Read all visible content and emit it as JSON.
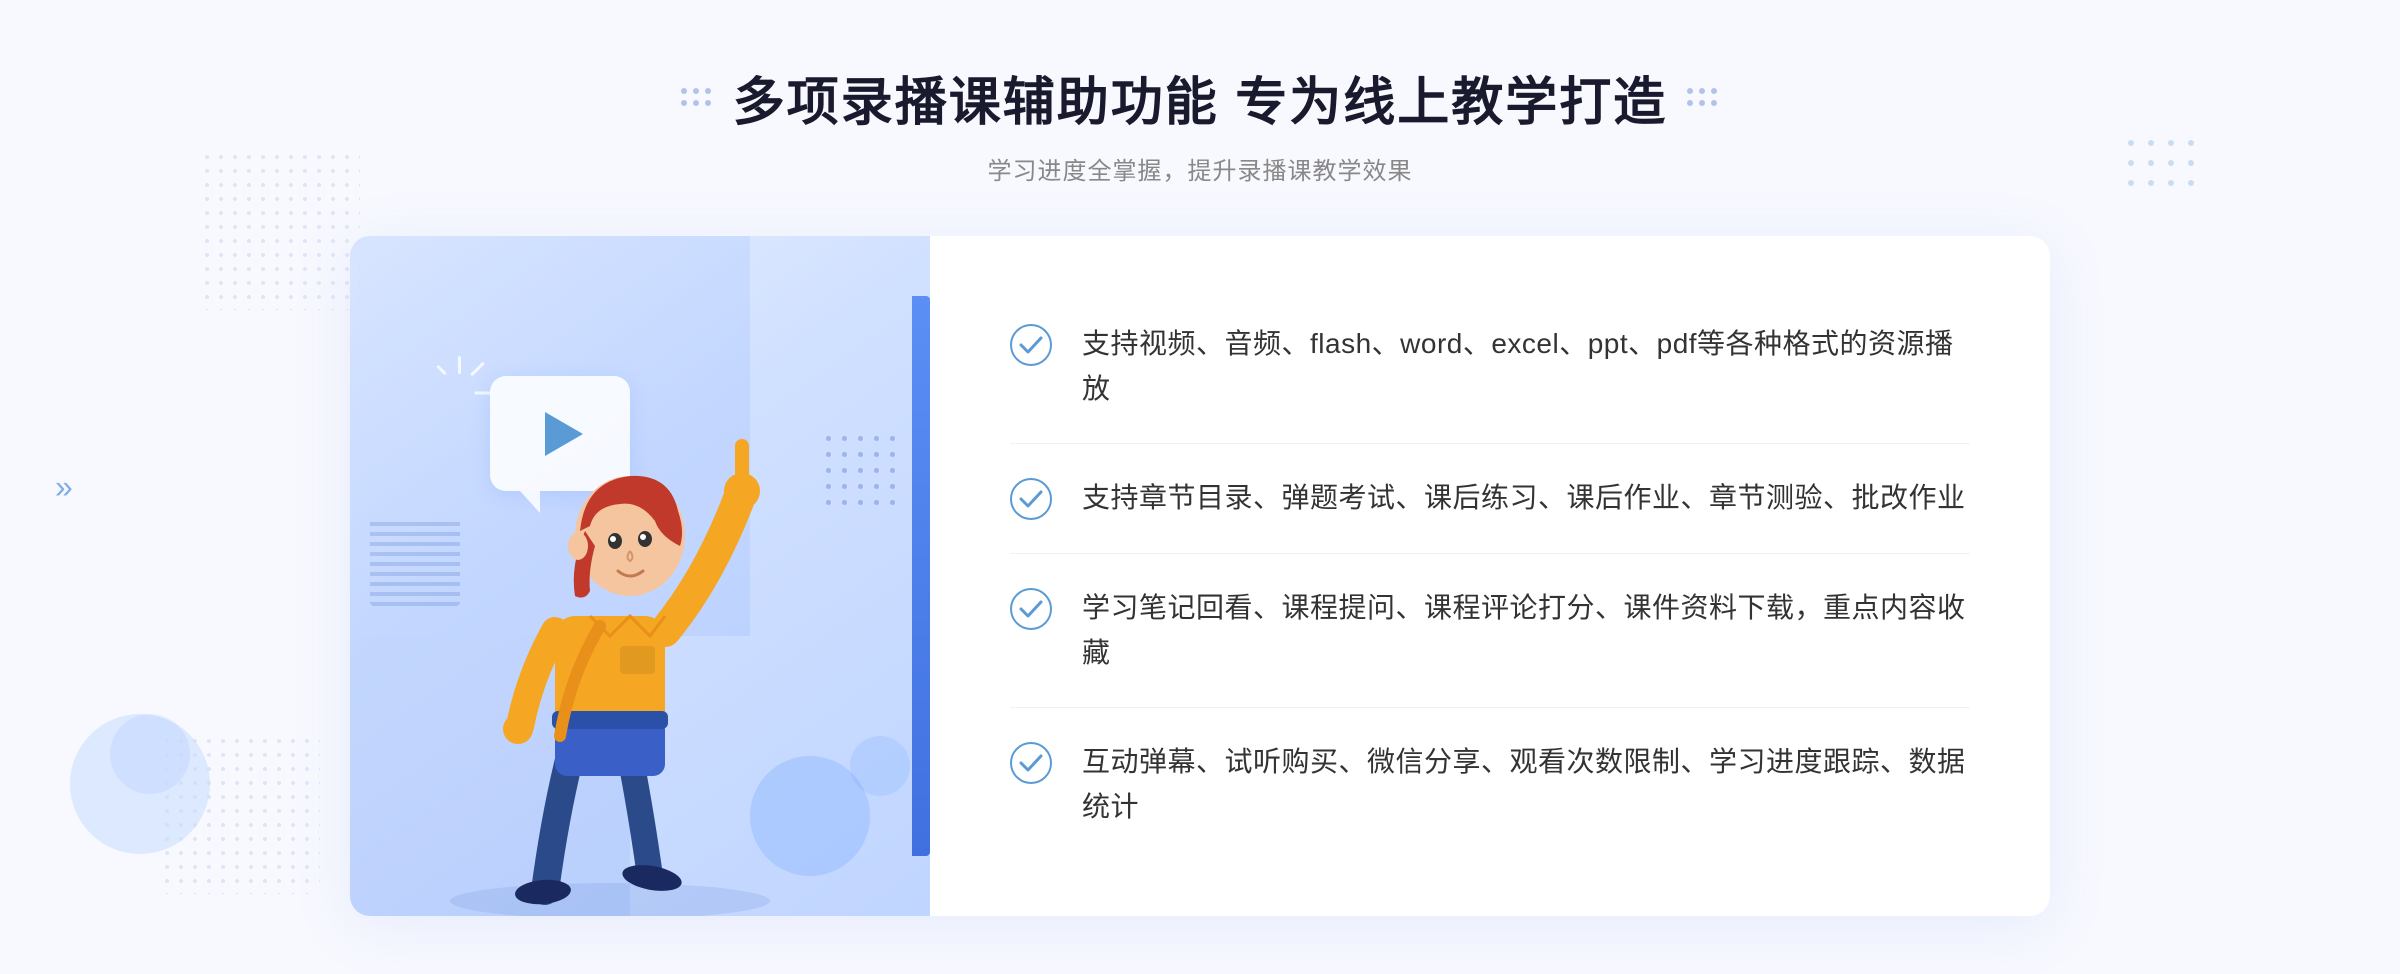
{
  "header": {
    "title": "多项录播课辅助功能 专为线上教学打造",
    "subtitle": "学习进度全掌握，提升录播课教学效果"
  },
  "features": [
    {
      "id": 1,
      "text": "支持视频、音频、flash、word、excel、ppt、pdf等各种格式的资源播放"
    },
    {
      "id": 2,
      "text": "支持章节目录、弹题考试、课后练习、课后作业、章节测验、批改作业"
    },
    {
      "id": 3,
      "text": "学习笔记回看、课程提问、课程评论打分、课件资料下载，重点内容收藏"
    },
    {
      "id": 4,
      "text": "互动弹幕、试听购买、微信分享、观看次数限制、学习进度跟踪、数据统计"
    }
  ],
  "decorative": {
    "chevrons_left": "»",
    "play_icon": "▶"
  }
}
